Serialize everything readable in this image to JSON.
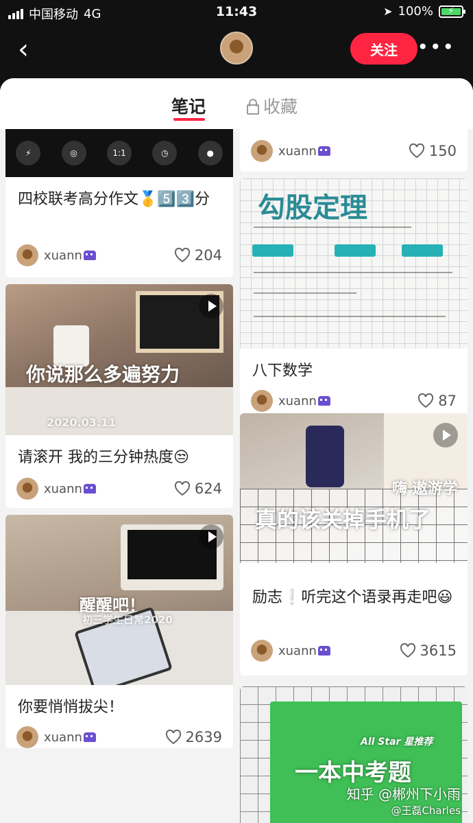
{
  "status_bar": {
    "carrier": "中国移动",
    "network": "4G",
    "time": "11:43",
    "battery": "100%"
  },
  "header": {
    "follow_label": "关注",
    "more_glyph": "•••",
    "back_glyph": "‹"
  },
  "tabs": [
    {
      "label": "笔记",
      "active": true
    },
    {
      "label": "收藏",
      "active": false
    }
  ],
  "notes_left": [
    {
      "title": "四校联考高分作文🥇5️⃣3️⃣分",
      "user": "xuann",
      "likes": "204",
      "has_video": false
    },
    {
      "title": "请滚开 我的三分钟热度😒",
      "user": "xuann",
      "likes": "624",
      "has_video": true,
      "overlay": "你说那么多遍努力",
      "overlay2": "2020.03.11"
    },
    {
      "title": "你要悄悄拔尖！",
      "user": "xuann",
      "likes": "2639",
      "has_video": true,
      "overlay": "醒醒吧！",
      "overlay2": "初三学生日常2020"
    }
  ],
  "notes_right": [
    {
      "title": "",
      "user": "xuann",
      "likes": "150"
    },
    {
      "title": "八下数学",
      "user": "xuann",
      "likes": "87",
      "has_video": false,
      "overlay": "勾股定理"
    },
    {
      "title": "励志❕听完这个语录再走吧😃",
      "user": "xuann",
      "likes": "3615",
      "has_video": true,
      "overlay": "真的该关掉手机了",
      "overlay_top": "嗨 遨游学"
    },
    {
      "title": "",
      "user": "",
      "likes": "",
      "overlay": "一本中考题",
      "overlay_top": "All Star 星推荐"
    }
  ],
  "watermark": {
    "line1": "知乎 @郴州下小雨",
    "line2": "@王磊Charles"
  },
  "colors": {
    "accent": "#ff2442",
    "background": "#f3f3f3",
    "card": "#ffffff"
  },
  "icons": [
    "back-icon",
    "avatar",
    "more-icon",
    "lock-icon",
    "heart-icon",
    "play-icon",
    "alien-badge-icon"
  ]
}
